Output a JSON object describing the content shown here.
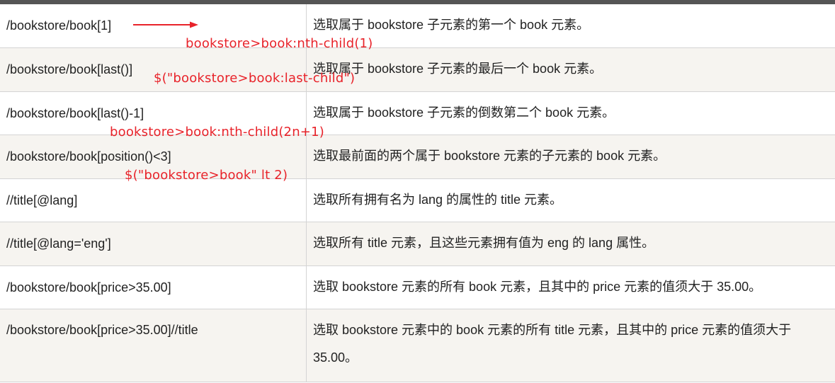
{
  "rows": [
    {
      "expr": "/bookstore/book[1]",
      "desc": "选取属于 bookstore 子元素的第一个 book 元素。"
    },
    {
      "expr": "/bookstore/book[last()]",
      "desc": "选取属于 bookstore 子元素的最后一个 book 元素。"
    },
    {
      "expr": "/bookstore/book[last()-1]",
      "desc": "选取属于 bookstore 子元素的倒数第二个 book 元素。"
    },
    {
      "expr": "/bookstore/book[position()<3]",
      "desc": "选取最前面的两个属于 bookstore 元素的子元素的 book 元素。"
    },
    {
      "expr": "//title[@lang]",
      "desc": "选取所有拥有名为 lang 的属性的 title 元素。"
    },
    {
      "expr": "//title[@lang='eng']",
      "desc": "选取所有 title 元素，且这些元素拥有值为 eng 的 lang 属性。"
    },
    {
      "expr": "/bookstore/book[price>35.00]",
      "desc": "选取 bookstore 元素的所有 book 元素，且其中的 price 元素的值须大于 35.00。"
    },
    {
      "expr": "/bookstore/book[price>35.00]//title",
      "desc": "选取 bookstore 元素中的 book 元素的所有 title 元素，且其中的 price 元素的值须大于 35.00。"
    }
  ],
  "annotations": {
    "a1": "bookstore>book:nth-child(1)",
    "a2": "$(\"bookstore>book:last-child\")",
    "a3": "bookstore>book:nth-child(2n+1)",
    "a4": "$(\"bookstore>book\" lt 2)"
  },
  "colors": {
    "annotation": "#e8232a",
    "header_bar": "#555555",
    "alt_row": "#f6f4f0"
  }
}
